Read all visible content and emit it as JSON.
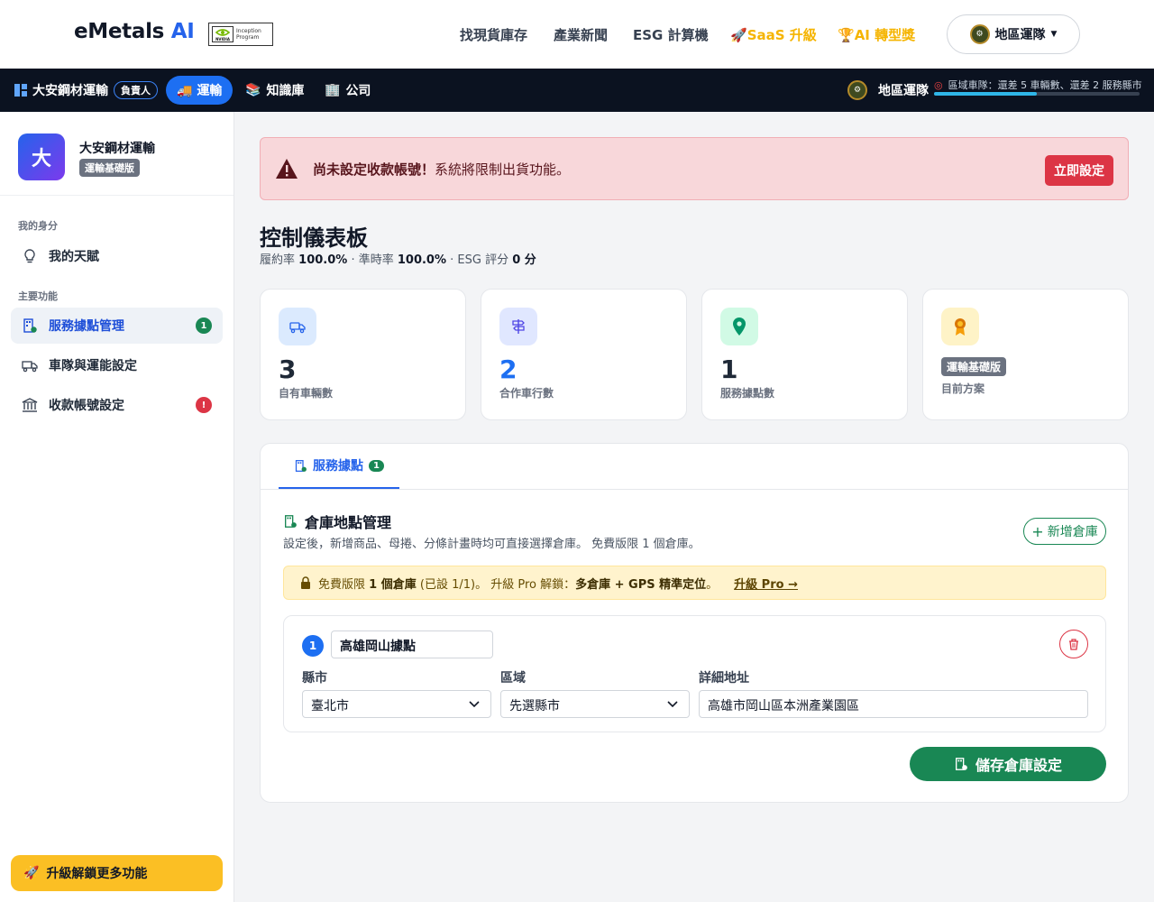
{
  "brand": {
    "name": "eMetals",
    "ai": "AI",
    "badge_line1": "Inception",
    "badge_line2": "Program",
    "badge_logo": "NVIDIA"
  },
  "topnav": {
    "items": [
      {
        "label": "找現貨庫存"
      },
      {
        "label": "產業新聞"
      },
      {
        "label": "ESG 計算機"
      },
      {
        "label": "SaaS 升級",
        "color": "#f5b400",
        "icon": "rocket-icon"
      },
      {
        "label": "AI 轉型獎",
        "color": "#f5b400",
        "icon": "trophy-icon"
      }
    ],
    "region_button": "地區運隊"
  },
  "darkbar": {
    "company": "大安鋼材運輸",
    "role_badge": "負責人",
    "active_tab": "運輸",
    "tab_knowledge": "知識庫",
    "tab_company": "公司",
    "region_label": "地區運隊",
    "region_status": "區域車隊：還差 5 車輛數、還差 2 服務縣市",
    "progress_fraction": 0.5
  },
  "sidebar": {
    "avatar_letter": "大",
    "company": "大安鋼材運輸",
    "tier": "運輸基礎版",
    "section_identity": "我的身分",
    "item_talent": "我的天賦",
    "section_main": "主要功能",
    "items": [
      {
        "label": "服務據點管理",
        "badge": "1",
        "badge_color": "#198754"
      },
      {
        "label": "車隊與運能設定"
      },
      {
        "label": "收款帳號設定",
        "badge": "!",
        "badge_color": "#dc3545"
      }
    ],
    "upgrade": "升級解鎖更多功能"
  },
  "alert": {
    "bold": "尚未設定收款帳號！",
    "text": "系統將限制出貨功能。",
    "button": "立即設定"
  },
  "dashboard": {
    "title": "控制儀表板",
    "fulfill_label": "履約率",
    "fulfill_value": "100.0%",
    "ontime_label": "· 準時率",
    "ontime_value": "100.0%",
    "esg_label": "· ESG 評分",
    "esg_value": "0 分"
  },
  "stats": [
    {
      "value": "3",
      "label": "自有車輛數",
      "icon": "truck-icon",
      "color": "#1f2937"
    },
    {
      "value": "2",
      "label": "合作車行數",
      "icon": "signpost-icon",
      "color": "#1d6ff2"
    },
    {
      "value": "1",
      "label": "服務據點數",
      "icon": "map-pin-icon",
      "color": "#1f2937"
    },
    {
      "value": "運輸基礎版",
      "label": "目前方案",
      "icon": "award-icon"
    }
  ],
  "panel": {
    "tab_label": "服務據點",
    "tab_count": "1",
    "section_title": "倉庫地點管理",
    "section_desc": "設定後，新增商品、母捲、分條計畫時均可直接選擇倉庫。 免費版限 1 個倉庫。",
    "add_button": "新增倉庫",
    "warn_prefix": "免費版限",
    "warn_bold1": "1 個倉庫",
    "warn_mid": "(已設 1/1)。 升級 Pro 解鎖：",
    "warn_bold2": "多倉庫 + GPS 精準定位",
    "warn_suffix": "。",
    "warn_link": "升級 Pro →",
    "warehouse": {
      "index": "1",
      "name": "高雄岡山據點",
      "county_label": "縣市",
      "county_value": "臺北市",
      "district_label": "區域",
      "district_value": "先選縣市",
      "address_label": "詳細地址",
      "address_value": "高雄市岡山區本洲產業園區"
    },
    "save_button": "儲存倉庫設定"
  }
}
